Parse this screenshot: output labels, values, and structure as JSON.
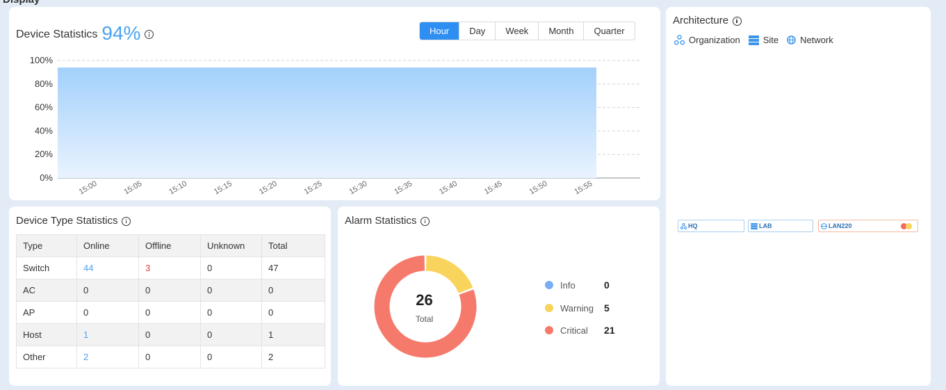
{
  "page": {
    "cut_title": "Display"
  },
  "device_statistics": {
    "title": "Device Statistics",
    "percent": "94%",
    "ranges": [
      "Hour",
      "Day",
      "Week",
      "Month",
      "Quarter"
    ],
    "active_range": "Hour"
  },
  "chart_data": {
    "type": "area",
    "title": "",
    "xlabel": "",
    "ylabel": "",
    "x": [
      "15:00",
      "15:05",
      "15:10",
      "15:15",
      "15:20",
      "15:25",
      "15:30",
      "15:35",
      "15:40",
      "15:45",
      "15:50",
      "15:55"
    ],
    "values": [
      94,
      94,
      94,
      94,
      94,
      94,
      94,
      94,
      94,
      94,
      94,
      94
    ],
    "yticks": [
      "0%",
      "20%",
      "40%",
      "60%",
      "80%",
      "100%"
    ],
    "ylim": [
      0,
      100
    ],
    "grid": true
  },
  "device_type_statistics": {
    "title": "Device Type Statistics",
    "columns": [
      "Type",
      "Online",
      "Offline",
      "Unknown",
      "Total"
    ],
    "rows": [
      [
        "Switch",
        "44",
        "3",
        "0",
        "47"
      ],
      [
        "AC",
        "0",
        "0",
        "0",
        "0"
      ],
      [
        "AP",
        "0",
        "0",
        "0",
        "0"
      ],
      [
        "Host",
        "1",
        "0",
        "0",
        "1"
      ],
      [
        "Other",
        "2",
        "0",
        "0",
        "2"
      ]
    ]
  },
  "alarm_statistics": {
    "title": "Alarm Statistics",
    "total": "26",
    "total_label": "Total",
    "legend": [
      {
        "label": "Info",
        "value": "0",
        "color": "#7aaef4"
      },
      {
        "label": "Warning",
        "value": "5",
        "color": "#f9d45c"
      },
      {
        "label": "Critical",
        "value": "21",
        "color": "#f67a6c"
      }
    ]
  },
  "architecture": {
    "title": "Architecture",
    "legend": [
      "Organization",
      "Site",
      "Network"
    ],
    "nodes": [
      {
        "label": "HQ",
        "icon": "organization-icon"
      },
      {
        "label": "LAB",
        "icon": "site-icon"
      },
      {
        "label": "LAN220",
        "icon": "network-icon"
      }
    ]
  }
}
